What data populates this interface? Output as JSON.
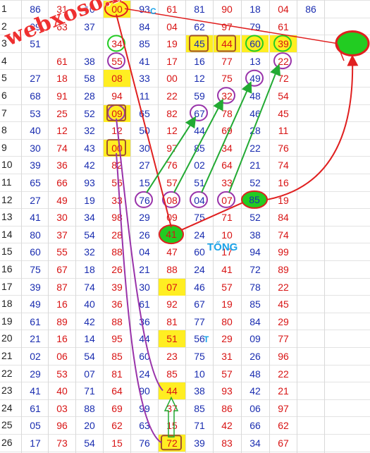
{
  "watermark": "webxoso.net",
  "labels": {
    "tong": "TỔNG",
    "t": "T",
    "c": "C"
  },
  "colors": {
    "red": "#d81414",
    "blue": "#1a2db0",
    "highlight": "#ffee22",
    "green": "#22cc22",
    "purple": "#9933aa"
  },
  "rows": [
    {
      "n": "1",
      "v": [
        "86",
        "31",
        "10",
        "00",
        "93",
        "61",
        "81",
        "90",
        "18",
        "04",
        "86"
      ]
    },
    {
      "n": "2",
      "v": [
        "09",
        "63",
        "37",
        "",
        "84",
        "04",
        "62",
        "97",
        "79",
        "61",
        ""
      ]
    },
    {
      "n": "3",
      "v": [
        "51",
        "",
        "",
        "34",
        "85",
        "19",
        "45",
        "44",
        "60",
        "39",
        ""
      ]
    },
    {
      "n": "4",
      "v": [
        "",
        "61",
        "38",
        "55",
        "41",
        "17",
        "16",
        "77",
        "13",
        "22",
        ""
      ]
    },
    {
      "n": "5",
      "v": [
        "27",
        "18",
        "58",
        "08",
        "33",
        "00",
        "12",
        "75",
        "49",
        "72",
        ""
      ]
    },
    {
      "n": "6",
      "v": [
        "68",
        "91",
        "28",
        "94",
        "11",
        "22",
        "59",
        "32",
        "48",
        "54",
        ""
      ]
    },
    {
      "n": "7",
      "v": [
        "53",
        "25",
        "52",
        "09",
        "65",
        "82",
        "67",
        "78",
        "46",
        "45",
        ""
      ]
    },
    {
      "n": "8",
      "v": [
        "40",
        "12",
        "32",
        "12",
        "50",
        "12",
        "44",
        "69",
        "28",
        "11",
        ""
      ]
    },
    {
      "n": "9",
      "v": [
        "30",
        "74",
        "43",
        "00",
        "30",
        "97",
        "85",
        "34",
        "22",
        "76",
        ""
      ]
    },
    {
      "n": "10",
      "v": [
        "39",
        "36",
        "42",
        "82",
        "27",
        "76",
        "02",
        "64",
        "21",
        "74",
        ""
      ]
    },
    {
      "n": "11",
      "v": [
        "65",
        "66",
        "93",
        "56",
        "15",
        "57",
        "51",
        "33",
        "52",
        "16",
        ""
      ]
    },
    {
      "n": "12",
      "v": [
        "27",
        "49",
        "19",
        "33",
        "76",
        "08",
        "04",
        "07",
        "85",
        "19",
        ""
      ]
    },
    {
      "n": "13",
      "v": [
        "41",
        "30",
        "34",
        "98",
        "29",
        "09",
        "75",
        "71",
        "52",
        "84",
        ""
      ]
    },
    {
      "n": "14",
      "v": [
        "80",
        "37",
        "54",
        "28",
        "26",
        "41",
        "24",
        "10",
        "38",
        "74",
        ""
      ]
    },
    {
      "n": "15",
      "v": [
        "60",
        "55",
        "32",
        "88",
        "04",
        "47",
        "60",
        "17",
        "94",
        "99",
        ""
      ]
    },
    {
      "n": "16",
      "v": [
        "75",
        "67",
        "18",
        "26",
        "21",
        "88",
        "24",
        "41",
        "72",
        "89",
        ""
      ]
    },
    {
      "n": "17",
      "v": [
        "39",
        "87",
        "74",
        "39",
        "30",
        "07",
        "46",
        "57",
        "78",
        "22",
        ""
      ]
    },
    {
      "n": "18",
      "v": [
        "49",
        "16",
        "40",
        "36",
        "61",
        "92",
        "67",
        "19",
        "85",
        "45",
        ""
      ]
    },
    {
      "n": "19",
      "v": [
        "61",
        "89",
        "42",
        "88",
        "36",
        "81",
        "77",
        "80",
        "84",
        "29",
        ""
      ]
    },
    {
      "n": "20",
      "v": [
        "21",
        "16",
        "14",
        "95",
        "44",
        "51",
        "56",
        "29",
        "09",
        "77",
        ""
      ]
    },
    {
      "n": "21",
      "v": [
        "02",
        "06",
        "54",
        "85",
        "60",
        "23",
        "75",
        "31",
        "26",
        "96",
        ""
      ]
    },
    {
      "n": "22",
      "v": [
        "29",
        "53",
        "07",
        "81",
        "24",
        "85",
        "10",
        "57",
        "48",
        "22",
        ""
      ]
    },
    {
      "n": "23",
      "v": [
        "41",
        "40",
        "71",
        "64",
        "90",
        "44",
        "38",
        "93",
        "42",
        "21",
        ""
      ]
    },
    {
      "n": "24",
      "v": [
        "61",
        "03",
        "88",
        "69",
        "99",
        "37",
        "85",
        "86",
        "06",
        "97",
        ""
      ]
    },
    {
      "n": "25",
      "v": [
        "05",
        "96",
        "20",
        "62",
        "63",
        "15",
        "71",
        "42",
        "66",
        "62",
        ""
      ]
    },
    {
      "n": "26",
      "v": [
        "17",
        "73",
        "54",
        "15",
        "76",
        "72",
        "39",
        "83",
        "34",
        "67",
        ""
      ]
    }
  ]
}
